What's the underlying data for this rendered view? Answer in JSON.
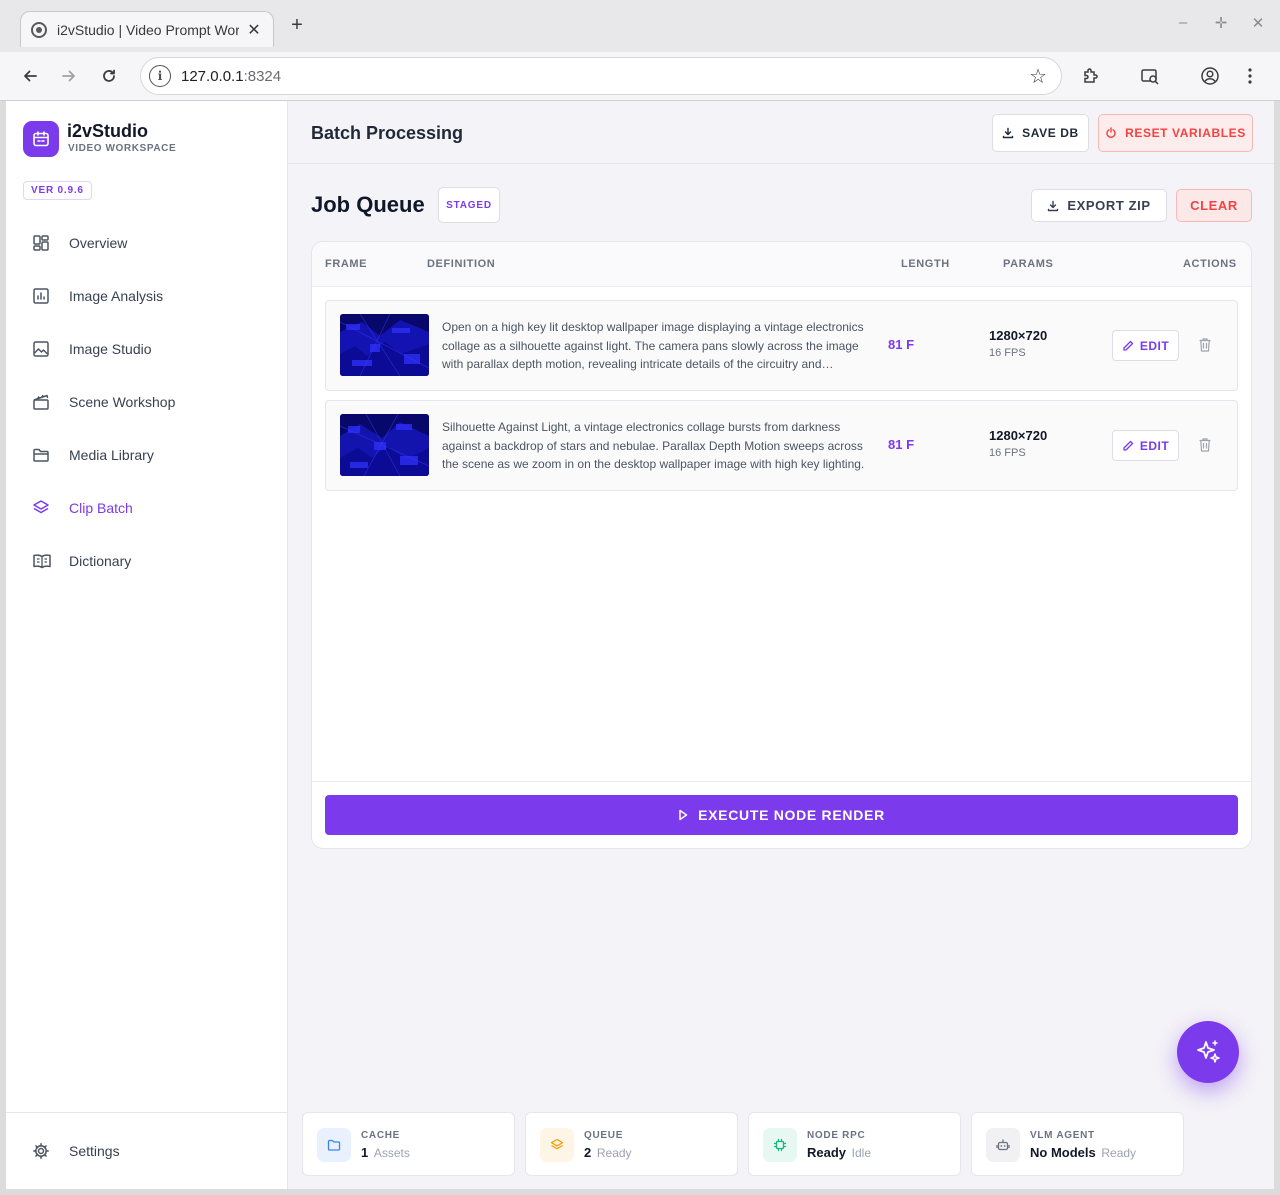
{
  "browser": {
    "tab_title": "i2vStudio | Video Prompt Workshop",
    "url_host": "127.0.0.1",
    "url_port": ":8324"
  },
  "brand": {
    "name": "i2vStudio",
    "subtitle": "VIDEO WORKSPACE",
    "version": "VER 0.9.6"
  },
  "sidebar": {
    "items": [
      {
        "label": "Overview",
        "icon": "grid-icon"
      },
      {
        "label": "Image Analysis",
        "icon": "chart-icon"
      },
      {
        "label": "Image Studio",
        "icon": "image-icon"
      },
      {
        "label": "Scene Workshop",
        "icon": "clapperboard-icon"
      },
      {
        "label": "Media Library",
        "icon": "folder-icon"
      },
      {
        "label": "Clip Batch",
        "icon": "layers-icon",
        "active": true
      },
      {
        "label": "Dictionary",
        "icon": "book-icon"
      }
    ],
    "settings_label": "Settings"
  },
  "topbar": {
    "title": "Batch Processing",
    "save_label": "SAVE DB",
    "reset_label": "RESET VARIABLES"
  },
  "queue": {
    "title": "Job Queue",
    "badge": "STAGED",
    "export_label": "EXPORT ZIP",
    "clear_label": "CLEAR",
    "columns": [
      "FRAME",
      "DEFINITION",
      "LENGTH",
      "PARAMS",
      "ACTIONS"
    ],
    "rows": [
      {
        "definition": "Open on a high key lit desktop wallpaper image displaying a vintage electronics collage as a silhouette against light. The camera pans slowly across the image with parallax depth motion, revealing intricate details of the circuitry and components.",
        "length": "81 F",
        "resolution": "1280×720",
        "fps": "16 FPS",
        "edit_label": "EDIT"
      },
      {
        "definition": "Silhouette Against Light, a vintage electronics collage bursts from darkness against a backdrop of stars and nebulae. Parallax Depth Motion sweeps across the scene as we zoom in on the desktop wallpaper image with high key lighting.",
        "length": "81 F",
        "resolution": "1280×720",
        "fps": "16 FPS",
        "edit_label": "EDIT"
      }
    ],
    "execute_label": "EXECUTE NODE RENDER"
  },
  "status": [
    {
      "label": "CACHE",
      "value": "1",
      "sub": "Assets",
      "icon": "folder-icon",
      "color": "#3b82f6",
      "bg": "#eaf1fe"
    },
    {
      "label": "QUEUE",
      "value": "2",
      "sub": "Ready",
      "icon": "layers-icon",
      "color": "#f59e0b",
      "bg": "#fef5e6"
    },
    {
      "label": "NODE RPC",
      "value": "Ready",
      "sub": "Idle",
      "icon": "chip-icon",
      "color": "#10b981",
      "bg": "#e7f7f1"
    },
    {
      "label": "VLM AGENT",
      "value": "No Models",
      "sub": "Ready",
      "icon": "robot-icon",
      "color": "#6b7280",
      "bg": "#f1f1f4"
    }
  ],
  "colors": {
    "accent": "#7c3aed",
    "danger": "#ef4444"
  }
}
